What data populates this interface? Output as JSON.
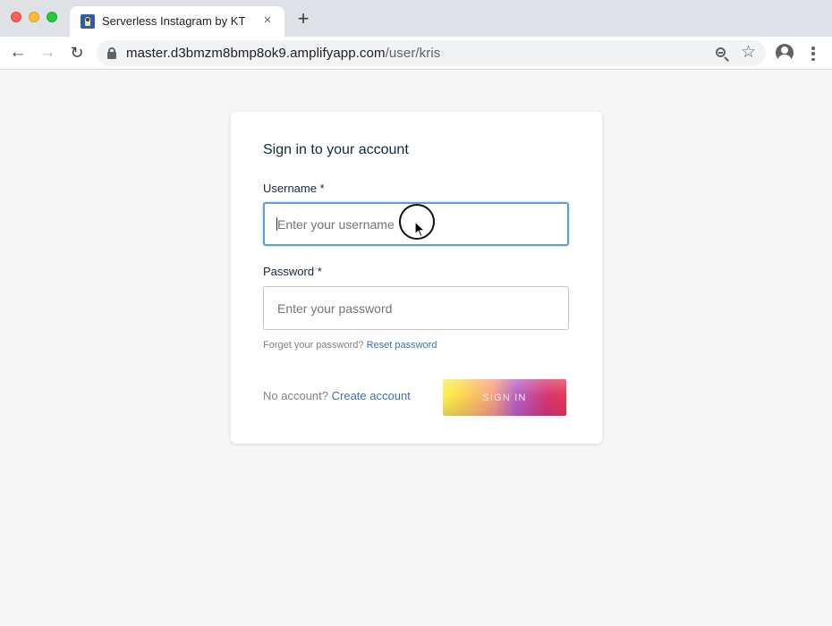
{
  "browser": {
    "tab_title": "Serverless Instagram by KT",
    "tab_close": "×",
    "new_tab": "+",
    "url_host": "master.d3bmzm8bmp8ok9.amplifyapp.com",
    "url_path": "/user/kris",
    "nav_back": "←",
    "nav_forward": "→",
    "nav_reload": "↻",
    "bookmark": "☆"
  },
  "signin": {
    "title": "Sign in to your account",
    "username_label": "Username *",
    "username_placeholder": "Enter your username",
    "password_label": "Password *",
    "password_placeholder": "Enter your password",
    "forgot_text": "Forget your password?",
    "reset_link": "Reset password",
    "no_account_text": "No account?",
    "create_link": "Create account",
    "submit_label": "SIGN IN"
  },
  "colors": {
    "link": "#3b73a8",
    "focus": "#5f9ed6",
    "text": "#152939"
  }
}
